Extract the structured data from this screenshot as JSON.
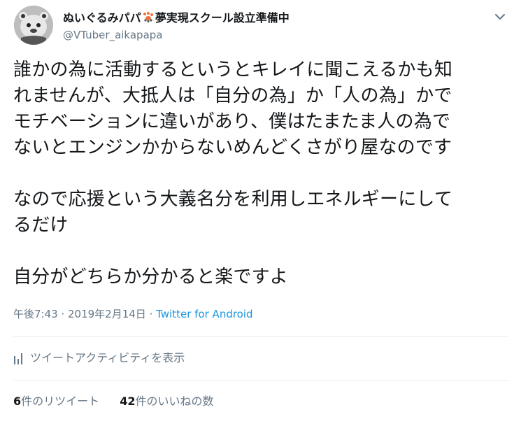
{
  "user": {
    "display_name_prefix": "ぬいぐるみパパ",
    "display_name_suffix": "夢実現スクール設立準備中",
    "handle": "@VTuber_aikapapa",
    "avatar_icon": "plush-bear-avatar",
    "paw_icon": "paw-prints-icon"
  },
  "menu": {
    "icon": "chevron-down-icon"
  },
  "tweet": {
    "text": "誰かの為に活動するというとキレイに聞こえるかも知\nれませんが、大抵人は「自分の為」か「人の為」かで\nモチベーションに違いがあり、僕はたまたま人の為で\nないとエンジンかからないめんどくさがり屋なのです\n\nなので応援という大義名分を利用しエネルギーにして\nるだけ\n\n自分がどちらか分かると楽ですよ",
    "time": "午後7:43",
    "separator": " · ",
    "date": "2019年2月14日",
    "source": "Twitter for Android"
  },
  "activity": {
    "icon": "bar-chart-icon",
    "label": "ツイートアクティビティを表示"
  },
  "stats": {
    "retweets_count": "6",
    "retweets_label": "件のリツイート",
    "likes_count": "42",
    "likes_label": "件のいいねの数"
  },
  "colors": {
    "text": "#14171a",
    "secondary": "#657786",
    "link": "#1b95e0",
    "divider": "#e6ecf0",
    "paw": "#e8733b"
  }
}
